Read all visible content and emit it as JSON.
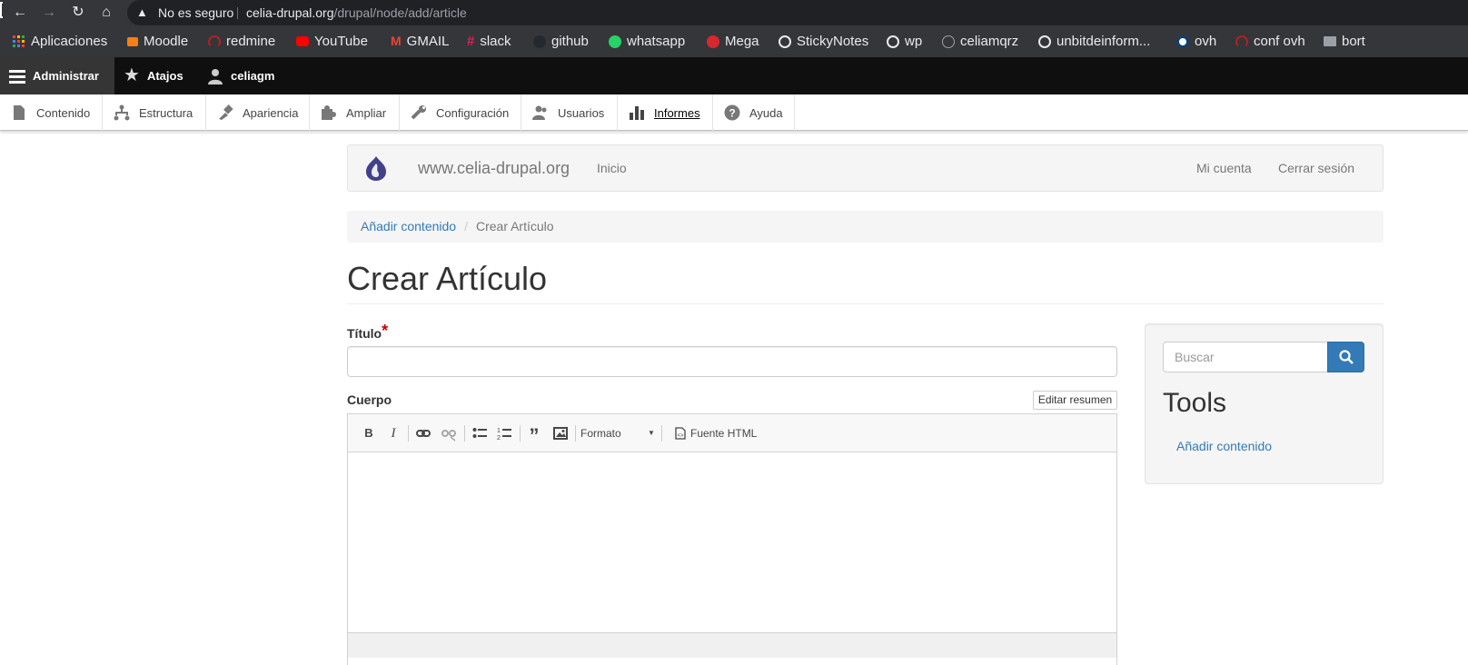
{
  "browser": {
    "security_label": "No es seguro",
    "url_host": "celia-drupal.org",
    "url_path": "/drupal/node/add/article",
    "bookmarks": [
      {
        "label": "Aplicaciones",
        "icon": "apps-grid-icon",
        "color": "#ea4335"
      },
      {
        "label": "Moodle",
        "icon": "moodle-icon",
        "color": "#f98012"
      },
      {
        "label": "redmine",
        "icon": "redmine-icon",
        "color": "#b32024"
      },
      {
        "label": "YouTube",
        "icon": "youtube-icon",
        "color": "#ff0000"
      },
      {
        "label": "GMAIL",
        "icon": "gmail-icon",
        "color": "#ea4335"
      },
      {
        "label": "slack",
        "icon": "slack-icon",
        "color": "#e01e5a"
      },
      {
        "label": "github",
        "icon": "github-icon",
        "color": "#24292e"
      },
      {
        "label": "whatsapp",
        "icon": "whatsapp-icon",
        "color": "#25d366"
      },
      {
        "label": "Mega",
        "icon": "mega-icon",
        "color": "#d9272e"
      },
      {
        "label": "StickyNotes",
        "icon": "globe-icon",
        "color": "#e8eaed"
      },
      {
        "label": "wp",
        "icon": "globe-icon",
        "color": "#e8eaed"
      },
      {
        "label": "celiamqrz",
        "icon": "clock-icon",
        "color": "#9aa0a6"
      },
      {
        "label": "unbitdeinform...",
        "icon": "globe-icon",
        "color": "#e8eaed"
      },
      {
        "label": "ovh",
        "icon": "ovh-icon",
        "color": "#123f6d"
      },
      {
        "label": "conf ovh",
        "icon": "redmine-icon",
        "color": "#b32024"
      },
      {
        "label": "bort",
        "icon": "folder-icon",
        "color": "#9aa0a6"
      }
    ]
  },
  "toolbar": {
    "manage": "Administrar",
    "shortcuts": "Atajos",
    "user": "celiagm"
  },
  "tray": [
    {
      "label": "Contenido",
      "icon": "file-icon"
    },
    {
      "label": "Estructura",
      "icon": "sitemap-icon"
    },
    {
      "label": "Apariencia",
      "icon": "paintbrush-icon"
    },
    {
      "label": "Ampliar",
      "icon": "puzzle-icon"
    },
    {
      "label": "Configuración",
      "icon": "wrench-icon"
    },
    {
      "label": "Usuarios",
      "icon": "people-icon"
    },
    {
      "label": "Informes",
      "icon": "bar-chart-icon"
    },
    {
      "label": "Ayuda",
      "icon": "help-icon"
    }
  ],
  "site": {
    "name": "www.celia-drupal.org",
    "home": "Inicio",
    "account": "Mi cuenta",
    "logout": "Cerrar sesión"
  },
  "breadcrumb": {
    "parent": "Añadir contenido",
    "separator": "/",
    "current": "Crear Artículo"
  },
  "page": {
    "title": "Crear Artículo"
  },
  "form": {
    "title_label": "Título",
    "required_mark": "*",
    "body_label": "Cuerpo",
    "summary_button": "Editar resumen",
    "format_label": "Formato",
    "source_label": "Fuente HTML"
  },
  "sidebar": {
    "search_placeholder": "Buscar",
    "tools_title": "Tools",
    "tools_link": "Añadir contenido"
  },
  "colors": {
    "link": "#337ab7",
    "toolbar_bg": "#0f0f0f",
    "required": "#cc0000"
  }
}
